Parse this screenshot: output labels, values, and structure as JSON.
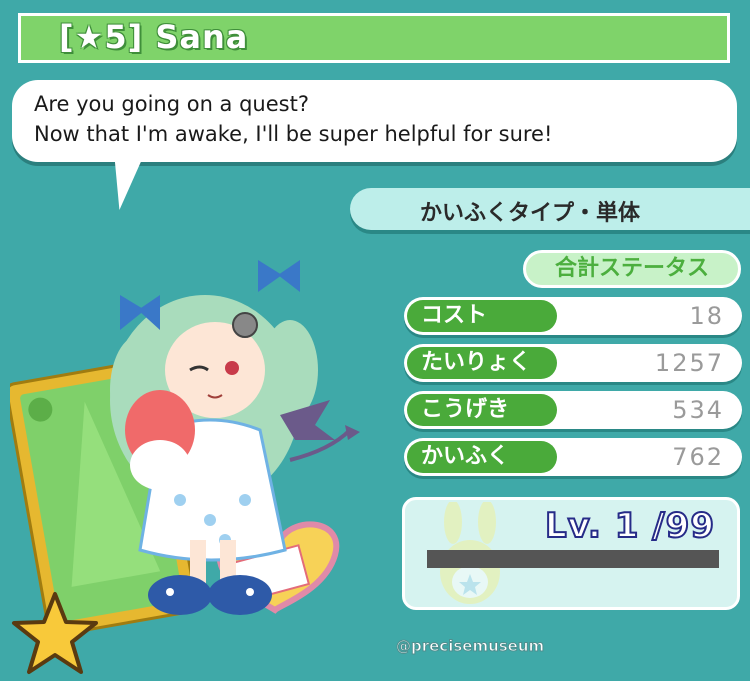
{
  "header": {
    "title": "[★5] Sana"
  },
  "dialogue": {
    "line1": "Are you going on a quest?",
    "line2": "Now that I'm awake, I'll be super helpful for sure!"
  },
  "card_type": "かいふくタイプ・単体",
  "stats_panel": {
    "header": "合計ステータス",
    "rows": [
      {
        "label": "コスト",
        "value": "18"
      },
      {
        "label": "たいりょく",
        "value": "1257"
      },
      {
        "label": "こうげき",
        "value": "534"
      },
      {
        "label": "かいふく",
        "value": "762"
      }
    ]
  },
  "level": {
    "text": "Lv. 1 /99",
    "exp_progress": 0.0
  },
  "watermark": "@precisemuseum",
  "colors": {
    "background": "#3fa9a8",
    "title_green": "#7fd36a",
    "stat_green": "#4aaa3a",
    "level_outline": "#262b88"
  }
}
